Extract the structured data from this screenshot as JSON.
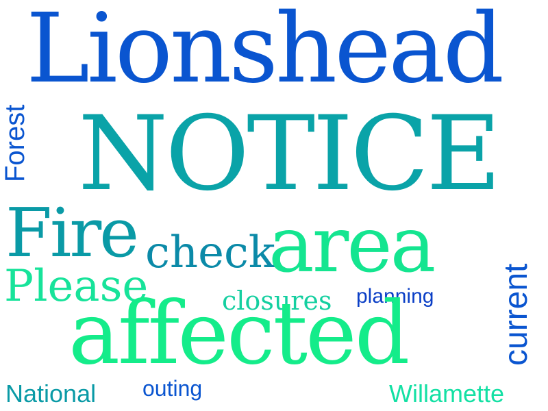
{
  "word_cloud": {
    "words": [
      {
        "text": "Lionshead",
        "color": "#0a55d0"
      },
      {
        "text": "NOTICE",
        "color": "#0aa3a8"
      },
      {
        "text": "Forest",
        "color": "#0a55d0",
        "orientation": "vertical"
      },
      {
        "text": "Fire",
        "color": "#0a9aa6"
      },
      {
        "text": "check",
        "color": "#0b8aa8"
      },
      {
        "text": "area",
        "color": "#14e590"
      },
      {
        "text": "current",
        "color": "#0a55d0",
        "orientation": "vertical"
      },
      {
        "text": "Please",
        "color": "#17e39a"
      },
      {
        "text": "closures",
        "color": "#14cfa0"
      },
      {
        "text": "planning",
        "color": "#0b3fc6"
      },
      {
        "text": "affected",
        "color": "#14ec8a"
      },
      {
        "text": "National",
        "color": "#0a9aa6"
      },
      {
        "text": "outing",
        "color": "#0a55d0"
      },
      {
        "text": "Willamette",
        "color": "#14e0a4"
      }
    ]
  }
}
